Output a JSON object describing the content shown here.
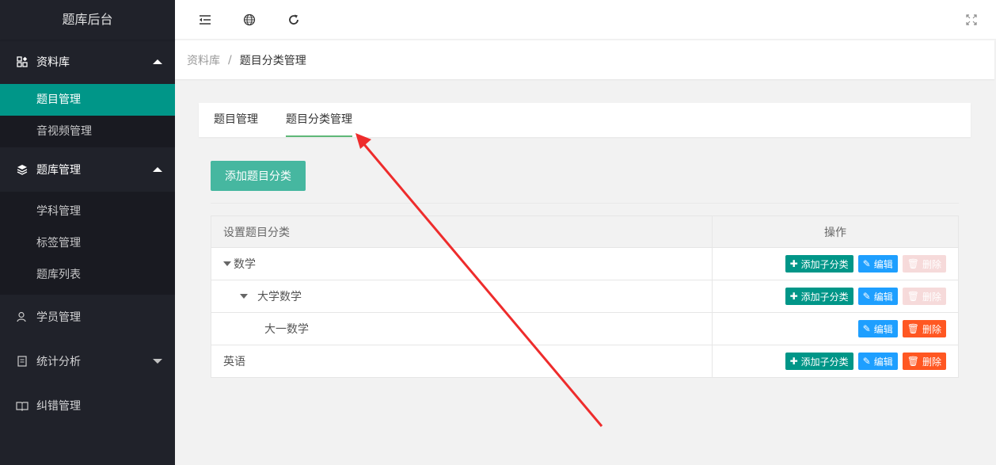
{
  "app": {
    "title": "题库后台"
  },
  "sidebar": {
    "groups": [
      {
        "label": "资料库",
        "icon": "grid-icon",
        "expanded": true,
        "items": [
          {
            "label": "题目管理",
            "active": true
          },
          {
            "label": "音视频管理"
          }
        ]
      },
      {
        "label": "题库管理",
        "icon": "layers-icon",
        "expanded": true,
        "items": [
          {
            "label": "学科管理"
          },
          {
            "label": "标签管理"
          },
          {
            "label": "题库列表"
          }
        ]
      },
      {
        "label": "学员管理",
        "icon": "user-icon"
      },
      {
        "label": "统计分析",
        "icon": "document-icon",
        "expanded": false
      },
      {
        "label": "纠错管理",
        "icon": "book-icon"
      }
    ]
  },
  "header": {
    "tools": [
      "menu-collapse-icon",
      "globe-icon",
      "refresh-icon",
      "fullscreen-icon"
    ]
  },
  "breadcrumb": {
    "home": "资料库",
    "separator": "/",
    "current": "题目分类管理"
  },
  "tabs": [
    {
      "label": "题目管理"
    },
    {
      "label": "题目分类管理",
      "active": true
    }
  ],
  "add_button": "添加题目分类",
  "table": {
    "col_name": "设置题目分类",
    "col_ops": "操作",
    "rows": [
      {
        "name": "数学",
        "level": 0,
        "has_children": true,
        "add_child": true,
        "delete_enabled": false
      },
      {
        "name": "大学数学",
        "level": 1,
        "has_children": true,
        "add_child": true,
        "delete_enabled": false
      },
      {
        "name": "大一数学",
        "level": 2,
        "has_children": false,
        "add_child": false,
        "delete_enabled": true
      },
      {
        "name": "英语",
        "level": 0,
        "has_children": false,
        "add_child": true,
        "delete_enabled": true
      }
    ],
    "labels": {
      "add_child": "添加子分类",
      "edit": "编辑",
      "delete": "删除"
    }
  },
  "colors": {
    "sidebar_bg": "#20222a",
    "active_item": "#009688",
    "add_btn": "#46b7a0",
    "edit": "#1e9fff",
    "delete": "#ff5722",
    "annotation_arrow": "#ee2c2c"
  }
}
